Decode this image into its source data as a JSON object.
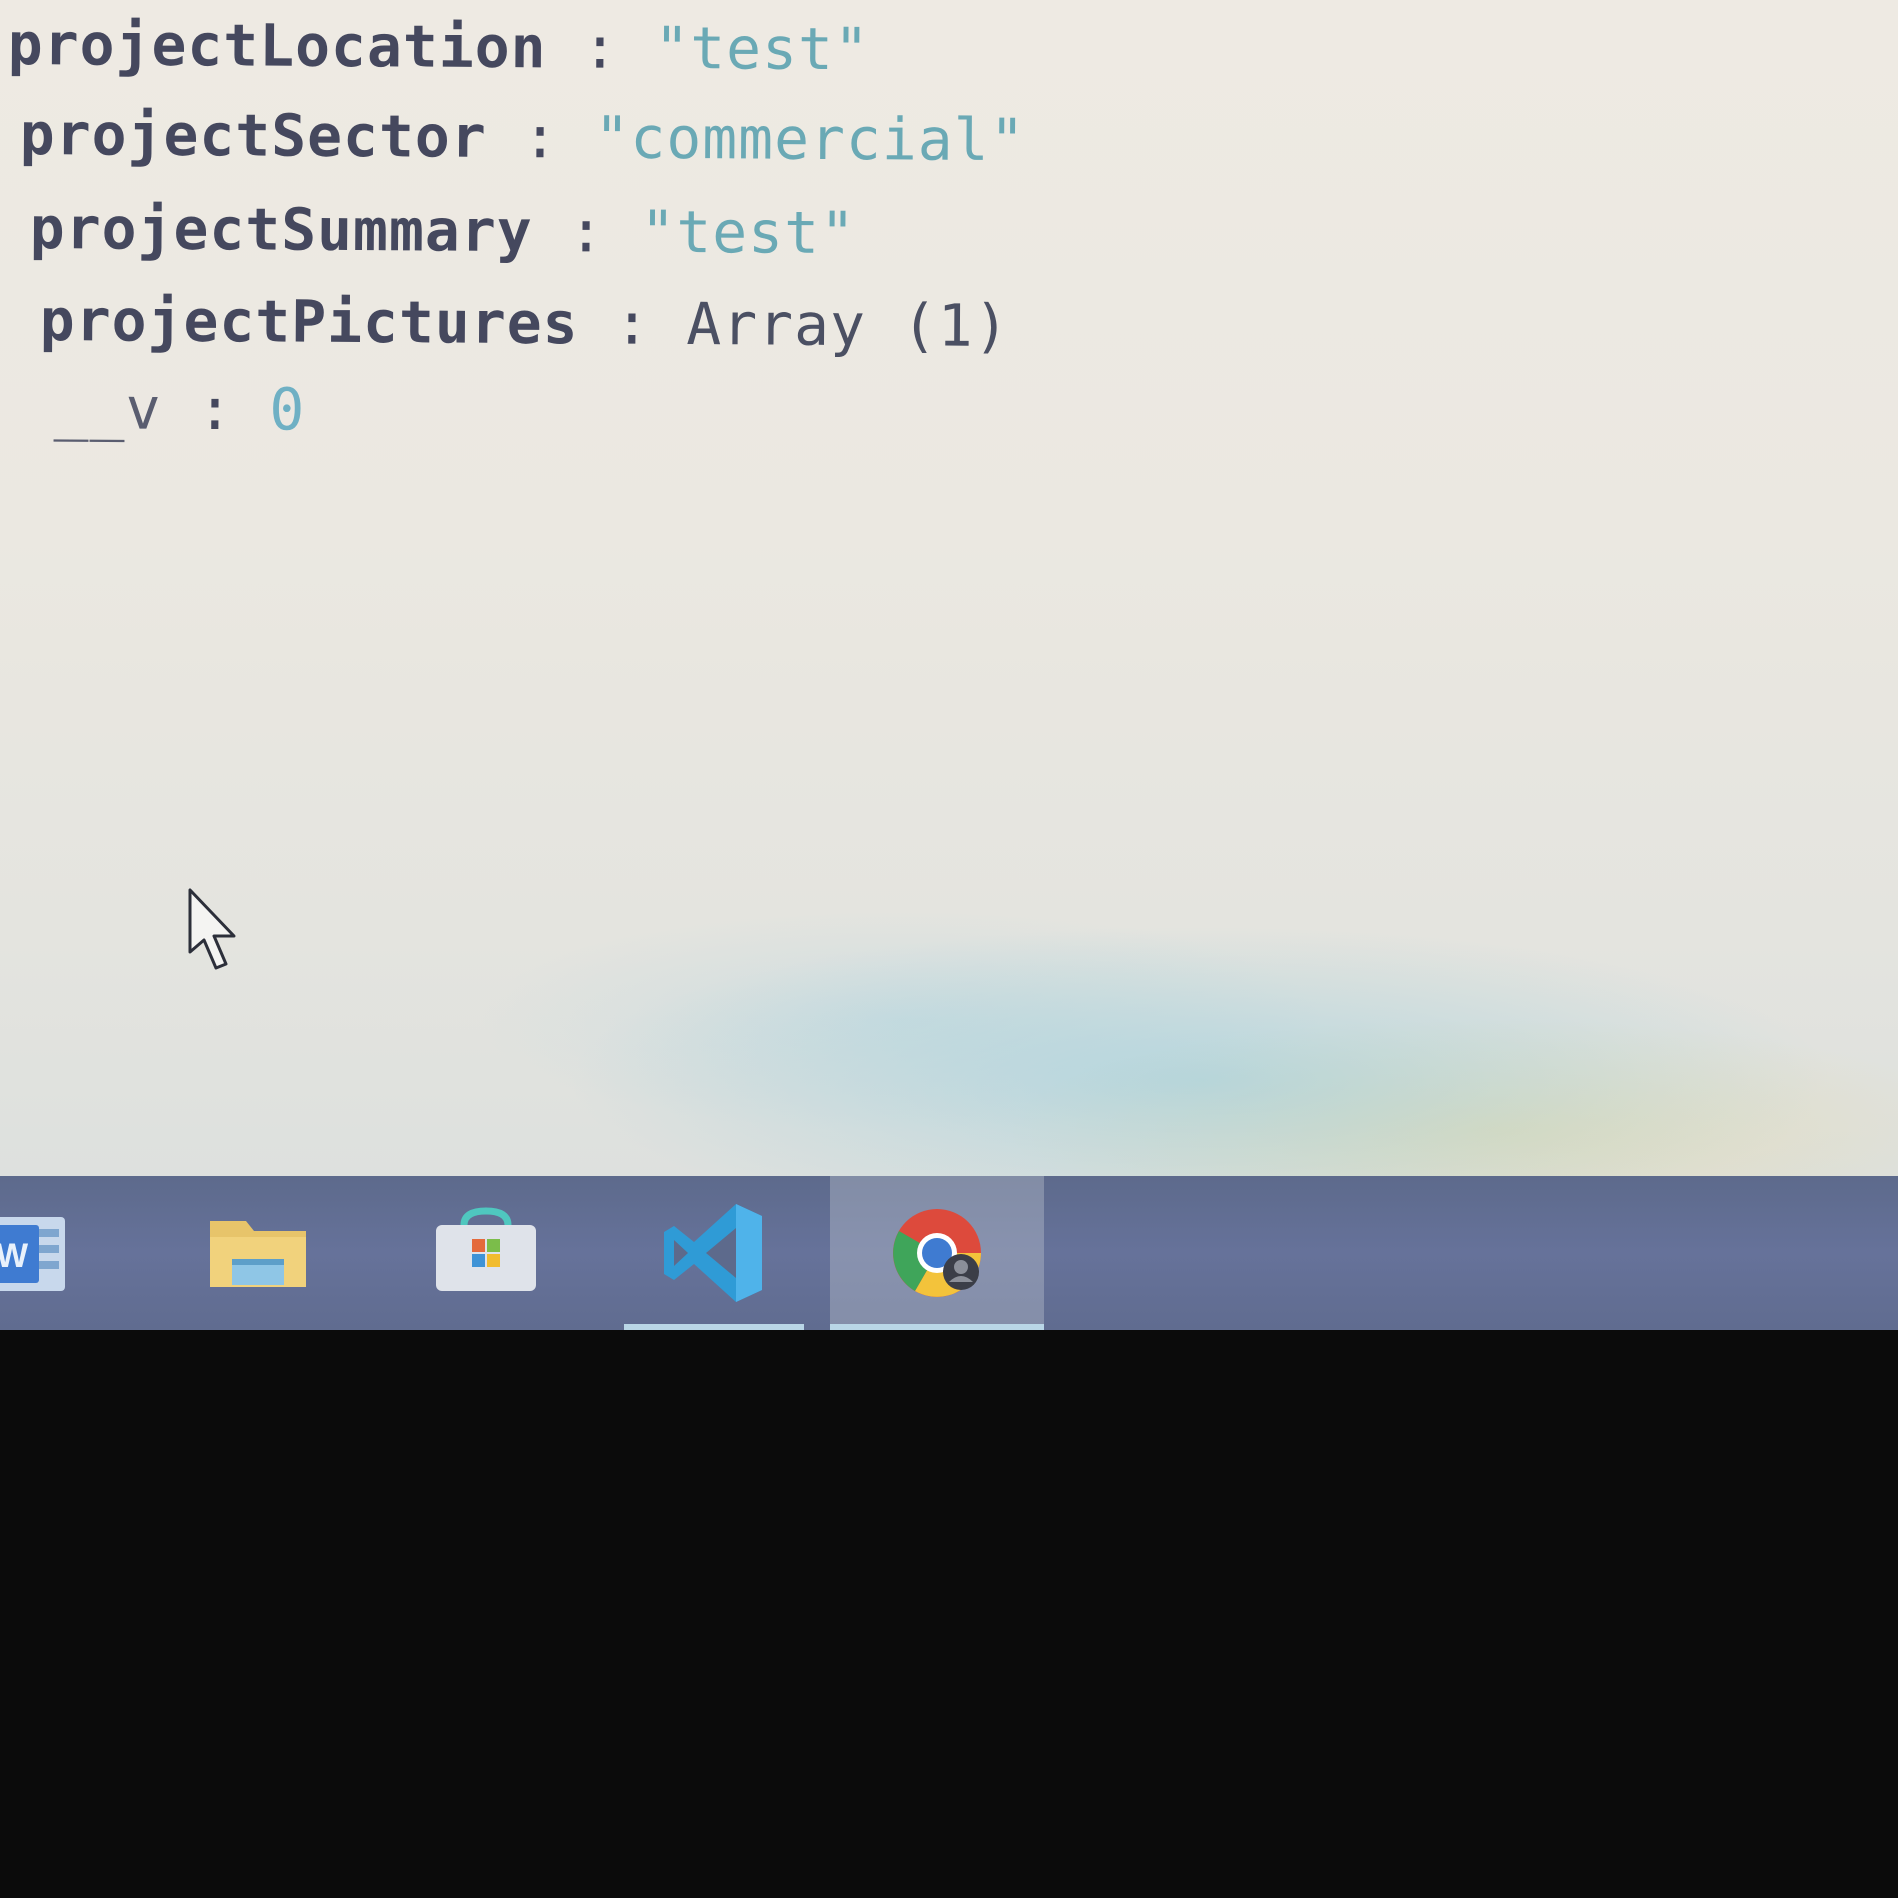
{
  "console": {
    "rows": [
      {
        "key": "projectLocation",
        "separator": " : ",
        "value": "\"test\""
      },
      {
        "key": "projectSector",
        "separator": " : ",
        "value": "\"commercial\""
      },
      {
        "key": "projectSummary",
        "separator": " : ",
        "value": "\"test\""
      },
      {
        "key": "projectPictures",
        "separator": " : ",
        "value": "Array (1)"
      },
      {
        "key": "__v",
        "separator": " : ",
        "value": "0"
      }
    ]
  },
  "taskbar": {
    "items": [
      {
        "icon": "word-icon",
        "active": false
      },
      {
        "icon": "file-explorer-icon",
        "active": false
      },
      {
        "icon": "microsoft-store-icon",
        "active": false
      },
      {
        "icon": "vscode-icon",
        "active": true
      },
      {
        "icon": "chrome-icon",
        "active": true,
        "hover": true
      }
    ]
  },
  "colors": {
    "console_key": "#45485e",
    "console_string": "#6aa9b5",
    "console_number": "#6fb0c4",
    "taskbar": "#5d6a8c",
    "vscode_blue": "#2f9bd6"
  }
}
